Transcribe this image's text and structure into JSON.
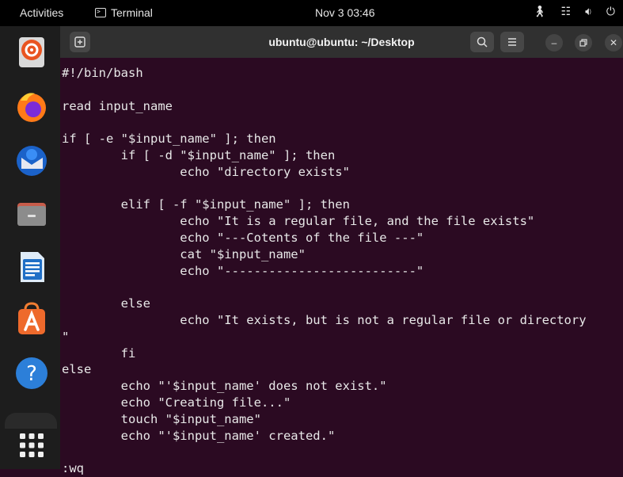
{
  "topbar": {
    "activities": "Activities",
    "app_name": "Terminal",
    "clock": "Nov 3  03:46"
  },
  "dock": {
    "items": [
      {
        "name": "ubuntu-installer-icon"
      },
      {
        "name": "firefox-icon"
      },
      {
        "name": "thunderbird-icon"
      },
      {
        "name": "files-icon"
      },
      {
        "name": "libreoffice-writer-icon"
      },
      {
        "name": "app-center-icon"
      },
      {
        "name": "help-icon"
      },
      {
        "name": "show-apps-icon"
      }
    ]
  },
  "window": {
    "title": "ubuntu@ubuntu: ~/Desktop"
  },
  "terminal": {
    "lines": [
      "#!/bin/bash",
      "",
      "read input_name",
      "",
      "if [ -e \"$input_name\" ]; then",
      "        if [ -d \"$input_name\" ]; then",
      "                echo \"directory exists\"",
      "",
      "        elif [ -f \"$input_name\" ]; then",
      "                echo \"It is a regular file, and the file exists\"",
      "                echo \"---Cotents of the file ---\"",
      "                cat \"$input_name\"",
      "                echo \"--------------------------\"",
      "",
      "        else",
      "                echo \"It exists, but is not a regular file or directory",
      "\"",
      "        fi",
      "else",
      "        echo \"'$input_name' does not exist.\"",
      "        echo \"Creating file...\"",
      "        touch \"$input_name\"",
      "        echo \"'$input_name' created.\"",
      "",
      ":wq"
    ]
  }
}
